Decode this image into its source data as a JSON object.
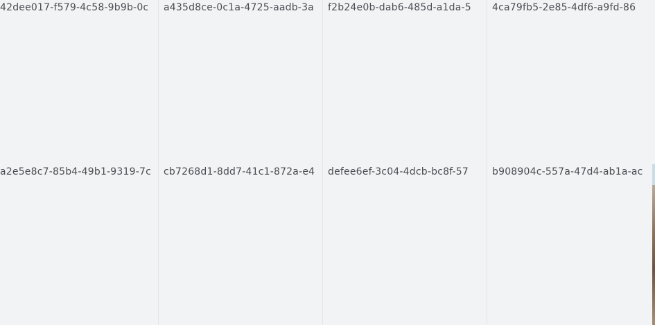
{
  "gallery": {
    "tiles": [
      {
        "name": "42dee017-f579-4c58-9b9b-0c"
      },
      {
        "name": "a435d8ce-0c1a-4725-aadb-3a"
      },
      {
        "name": "f2b24e0b-dab6-485d-a1da-5"
      },
      {
        "name": "4ca79fb5-2e85-4df6-a9fd-86"
      },
      {
        "name": "a2e5e8c7-85b4-49b1-9319-7c"
      },
      {
        "name": "cb7268d1-8dd7-41c1-872a-e4"
      },
      {
        "name": "defee6ef-3c04-4dcb-bc8f-57"
      },
      {
        "name": "b908904c-557a-47d4-ab1a-ac"
      }
    ]
  }
}
